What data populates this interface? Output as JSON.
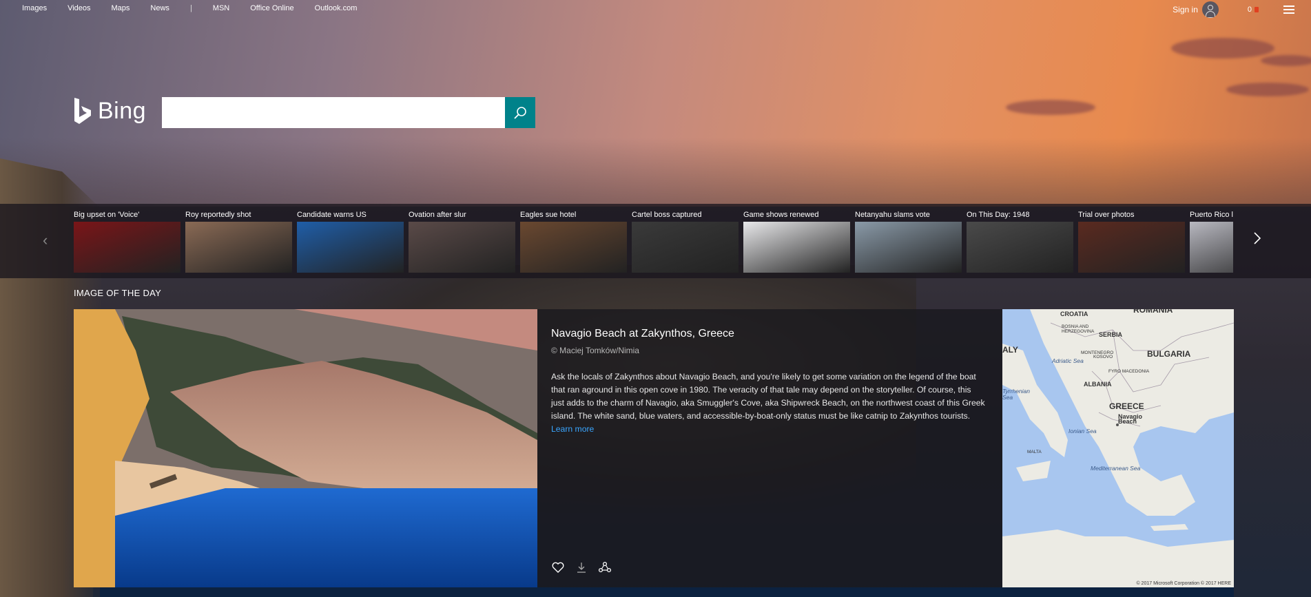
{
  "nav": {
    "links": [
      "Images",
      "Videos",
      "Maps",
      "News",
      "MSN",
      "Office Online",
      "Outlook.com"
    ],
    "separator": "|"
  },
  "account": {
    "signin_label": "Sign in",
    "rewards_count": "0"
  },
  "logo": {
    "text": "Bing"
  },
  "search": {
    "value": "",
    "placeholder": ""
  },
  "news": {
    "items": [
      {
        "title": "Big upset on 'Voice'",
        "thumb_color": "#7a1518"
      },
      {
        "title": "Roy reportedly shot",
        "thumb_color": "#8a6a55"
      },
      {
        "title": "Candidate warns US",
        "thumb_color": "#1f5ea8"
      },
      {
        "title": "Ovation after slur",
        "thumb_color": "#5a4a48"
      },
      {
        "title": "Eagles sue hotel",
        "thumb_color": "#6a4830"
      },
      {
        "title": "Cartel boss captured",
        "thumb_color": "#3a3a3a"
      },
      {
        "title": "Game shows renewed",
        "thumb_color": "#e8e8ea"
      },
      {
        "title": "Netanyahu slams vote",
        "thumb_color": "#8a9aa8"
      },
      {
        "title": "On This Day: 1948",
        "thumb_color": "#4a4a4a"
      },
      {
        "title": "Trial over photos",
        "thumb_color": "#5a2a20"
      },
      {
        "title": "Puerto Rico la",
        "thumb_color": "#b8b8c0"
      }
    ]
  },
  "iotd": {
    "section_title": "IMAGE OF THE DAY",
    "title": "Navagio Beach at Zakynthos, Greece",
    "credit": "© Maciej Tomków/Nimia",
    "description": "Ask the locals of Zakynthos about Navagio Beach, and you're likely to get some variation on the legend of the boat that ran aground in this open cove in 1980. The veracity of that tale may depend on the storyteller. Of course, this just adds to the charm of Navagio, aka Smuggler's Cove, aka Shipwreck Beach, on the northwest coast of this Greek island. The white sand, blue waters, and accessible-by-boat-only status must be like catnip to Zakynthos tourists.",
    "learn_more": "Learn more"
  },
  "map": {
    "labels": [
      {
        "text": "ROMANIA",
        "cls": "big"
      },
      {
        "text": "CROATIA",
        "cls": "small"
      },
      {
        "text": "BOSNIA AND HERZEGOVINA",
        "cls": "tiny"
      },
      {
        "text": "SERBIA",
        "cls": "small"
      },
      {
        "text": "ALY",
        "cls": "big"
      },
      {
        "text": "MONTENEGRO",
        "cls": "tiny"
      },
      {
        "text": "KOSOVO",
        "cls": "tiny"
      },
      {
        "text": "BULGARIA",
        "cls": "big"
      },
      {
        "text": "Adriatic Sea",
        "cls": "sea"
      },
      {
        "text": "FYRO MACEDONIA",
        "cls": "tiny"
      },
      {
        "text": "ALBANIA",
        "cls": "small"
      },
      {
        "text": "Tyrrhenian Sea",
        "cls": "sea"
      },
      {
        "text": "GREECE",
        "cls": "big"
      },
      {
        "text": "Navagio Beach",
        "cls": "small"
      },
      {
        "text": "Ionian Sea",
        "cls": "sea"
      },
      {
        "text": "MALTA",
        "cls": "tiny"
      },
      {
        "text": "Mediterranean Sea",
        "cls": "sea"
      }
    ],
    "copyright": "© 2017 Microsoft Corporation © 2017 HERE"
  }
}
